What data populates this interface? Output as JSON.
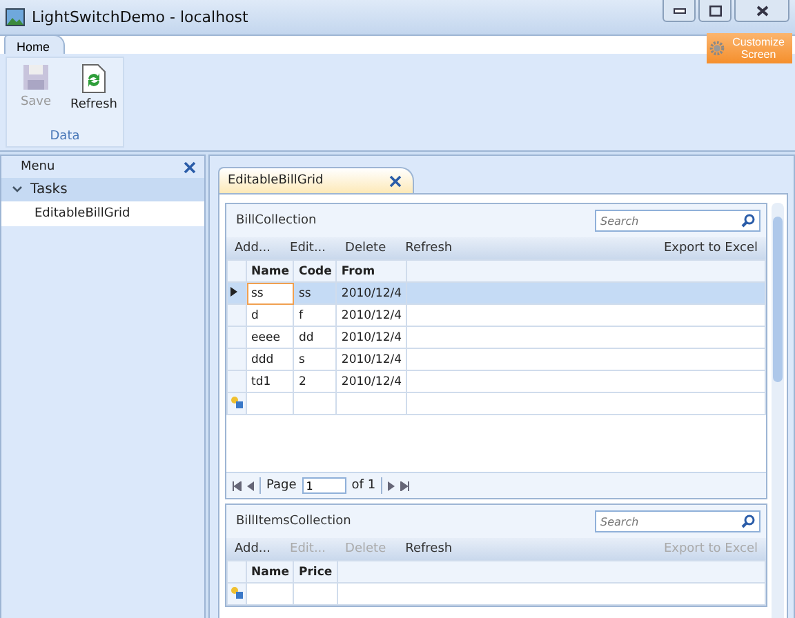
{
  "window": {
    "title": "LightSwitchDemo - localhost"
  },
  "ribbon": {
    "tabs": [
      {
        "label": "Home",
        "selected": true
      }
    ],
    "customize": "Customize Screen",
    "groups": [
      {
        "label": "Data",
        "buttons": [
          {
            "kind": "save",
            "label": "Save",
            "disabled": true
          },
          {
            "kind": "refresh",
            "label": "Refresh",
            "disabled": false
          }
        ]
      }
    ]
  },
  "menu": {
    "title": "Menu",
    "groups": [
      {
        "label": "Tasks",
        "expanded": true,
        "children": [
          {
            "label": "EditableBillGrid",
            "selected": false
          }
        ]
      }
    ]
  },
  "document_tabs": [
    {
      "label": "EditableBillGrid",
      "selected": true
    }
  ],
  "grids": [
    {
      "title": "BillCollection",
      "search": {
        "placeholder": "Search"
      },
      "commands": [
        {
          "label": "Add...",
          "disabled": false
        },
        {
          "label": "Edit...",
          "disabled": false
        },
        {
          "label": "Delete",
          "disabled": false
        },
        {
          "label": "Refresh",
          "disabled": false
        }
      ],
      "export": {
        "label": "Export to Excel",
        "disabled": false
      },
      "columns": [
        "Name",
        "Code",
        "From"
      ],
      "rows": [
        {
          "cells": [
            "ss",
            "ss",
            "2010/12/4"
          ],
          "selected": true
        },
        {
          "cells": [
            "d",
            "f",
            "2010/12/4"
          ],
          "selected": false
        },
        {
          "cells": [
            "eeee",
            "dd",
            "2010/12/4"
          ],
          "selected": false
        },
        {
          "cells": [
            "ddd",
            "s",
            "2010/12/4"
          ],
          "selected": false
        },
        {
          "cells": [
            "td1",
            "2",
            "2010/12/4"
          ],
          "selected": false
        }
      ],
      "pager": {
        "label": "Page",
        "value": "1",
        "total": "of 1"
      }
    },
    {
      "title": "BillItemsCollection",
      "search": {
        "placeholder": "Search"
      },
      "commands": [
        {
          "label": "Add...",
          "disabled": false
        },
        {
          "label": "Edit...",
          "disabled": true
        },
        {
          "label": "Delete",
          "disabled": true
        },
        {
          "label": "Refresh",
          "disabled": false
        }
      ],
      "export": {
        "label": "Export to Excel",
        "disabled": true
      },
      "columns": [
        "Name",
        "Price"
      ]
    }
  ]
}
